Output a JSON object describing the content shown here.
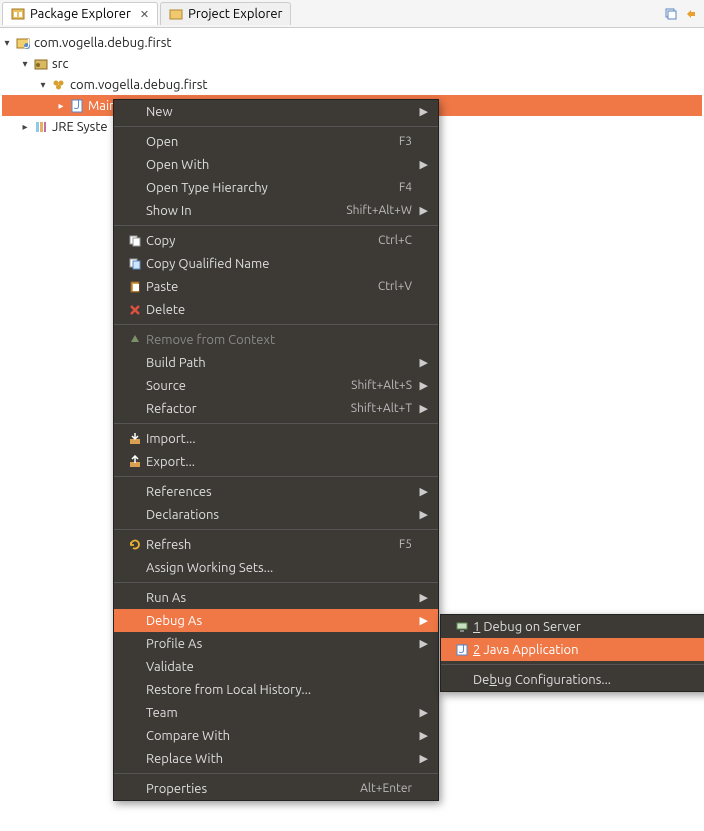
{
  "tabs": {
    "package_explorer": "Package Explorer",
    "project_explorer": "Project Explorer"
  },
  "tree": {
    "project": "com.vogella.debug.first",
    "src": "src",
    "pkg": "com.vogella.debug.first",
    "file": "Main.ja",
    "jre": "JRE Syste"
  },
  "menu": {
    "new": "New",
    "open": "Open",
    "open_sc": "F3",
    "open_with": "Open With",
    "open_type_hierarchy": "Open Type Hierarchy",
    "open_type_hierarchy_sc": "F4",
    "show_in": "Show In",
    "show_in_sc": "Shift+Alt+W",
    "copy": "Copy",
    "copy_sc": "Ctrl+C",
    "copy_qualified": "Copy Qualified Name",
    "paste": "Paste",
    "paste_sc": "Ctrl+V",
    "delete": "Delete",
    "remove_from_context": "Remove from Context",
    "build_path": "Build Path",
    "source": "Source",
    "source_sc": "Shift+Alt+S",
    "refactor": "Refactor",
    "refactor_sc": "Shift+Alt+T",
    "import": "Import...",
    "export": "Export...",
    "references": "References",
    "declarations": "Declarations",
    "refresh": "Refresh",
    "refresh_sc": "F5",
    "assign_ws": "Assign Working Sets...",
    "run_as": "Run As",
    "debug_as": "Debug As",
    "profile_as": "Profile As",
    "validate": "Validate",
    "restore": "Restore from Local History...",
    "team": "Team",
    "compare_with": "Compare With",
    "replace_with": "Replace With",
    "properties": "Properties",
    "properties_sc": "Alt+Enter"
  },
  "submenu": {
    "debug_on_server_num": "1",
    "debug_on_server": " Debug on Server",
    "java_app_num": "2",
    "java_app": " Java Application",
    "debug_config_pre": "De",
    "debug_config_mn": "b",
    "debug_config_post": "ug Configurations..."
  }
}
